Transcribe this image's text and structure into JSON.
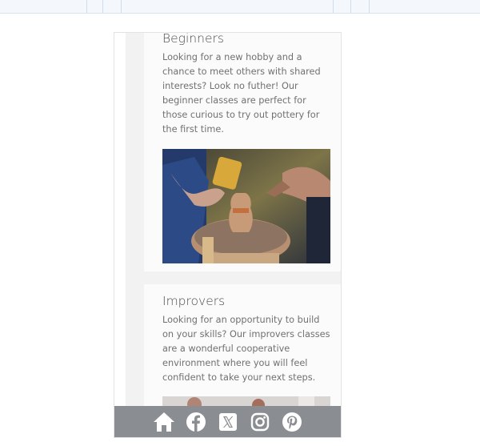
{
  "sections": [
    {
      "title": "Beginners",
      "text": "Looking for a new hobby and a chance to meet others with shared interests? Look no futher! Our beginner classes are perfect for those curious to try out pottery for the first time."
    },
    {
      "title": "Improvers",
      "text": "Looking for an opportunity to build on your skills? Our improvers classes are a wonderful cooperative environment where you will feel confident to take your next steps."
    }
  ],
  "footer": {
    "icons": [
      "home-icon",
      "facebook-icon",
      "x-twitter-icon",
      "instagram-icon",
      "pinterest-icon"
    ]
  },
  "colors": {
    "footer_bg": "#8a8d91",
    "card_bg": "#fbfbfb",
    "page_gutter": "#f2f2f2",
    "text": "#707070",
    "heading": "#4c4c4c"
  }
}
